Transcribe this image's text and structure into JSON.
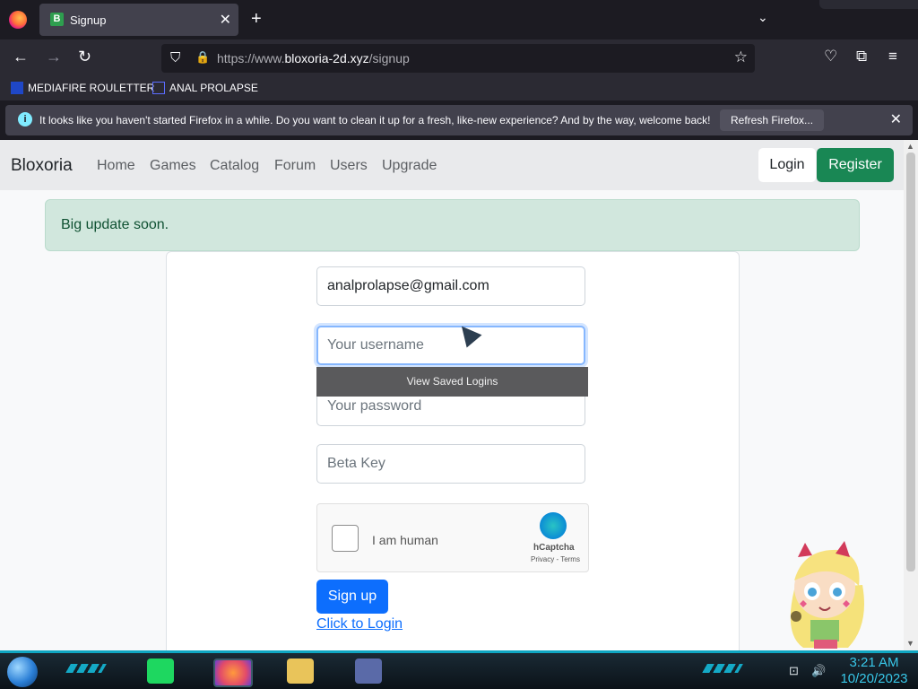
{
  "browser": {
    "tab": {
      "favicon_letter": "B",
      "title": "Signup"
    },
    "url": {
      "prefix": "https://www.",
      "domain": "bloxoria-2d.xyz",
      "path": "/signup"
    },
    "bookmarks": [
      {
        "label": "MEDIAFIRE ROULETTER"
      },
      {
        "label": "ANAL PROLAPSE"
      }
    ],
    "notification": {
      "message": "It looks like you haven't started Firefox in a while. Do you want to clean it up for a fresh, like-new experience? And by the way, welcome back!",
      "button": "Refresh Firefox..."
    }
  },
  "site": {
    "brand": "Bloxoria",
    "nav": [
      "Home",
      "Games",
      "Catalog",
      "Forum",
      "Users",
      "Upgrade"
    ],
    "login": "Login",
    "register": "Register",
    "alert": "Big update soon.",
    "form": {
      "email_value": "analprolapse@gmail.com",
      "username_placeholder": "Your username",
      "password_placeholder": "Your password",
      "betakey_placeholder": "Beta Key",
      "saved_logins": "View Saved Logins",
      "captcha_label": "I am human",
      "captcha_brand": "hCaptcha",
      "captcha_terms": "Privacy - Terms",
      "submit": "Sign up",
      "login_link": "Click to Login"
    },
    "accent_colors": {
      "primary": "#0d6efd",
      "success": "#198754",
      "alert_bg": "#d1e7dd"
    }
  },
  "taskbar": {
    "time": "3:21 AM",
    "date": "10/20/2023"
  }
}
